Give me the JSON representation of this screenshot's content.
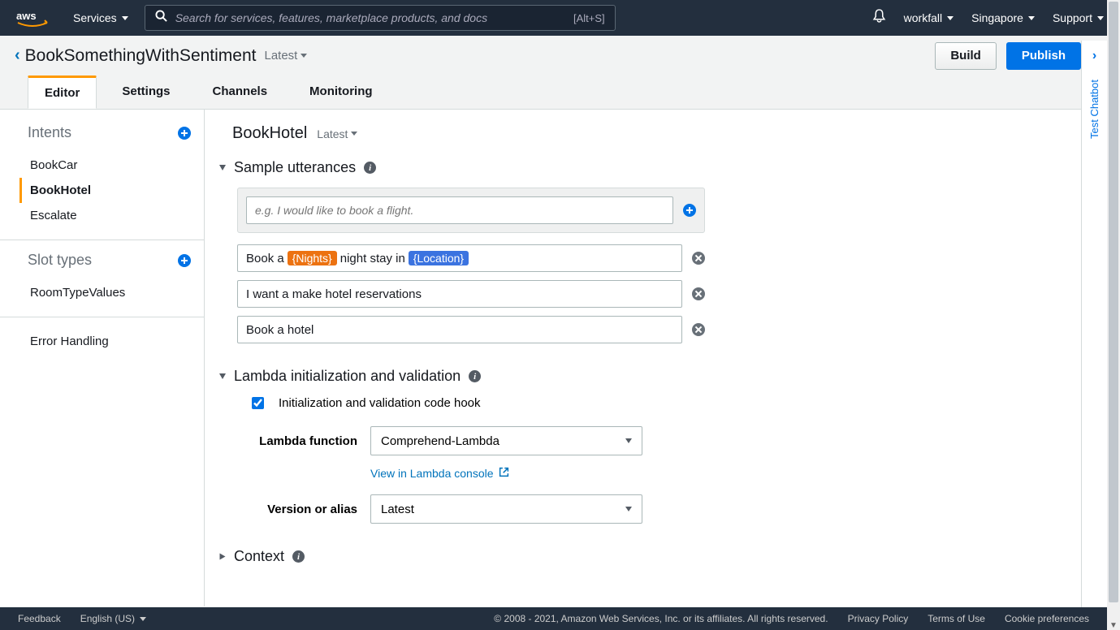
{
  "topnav": {
    "services": "Services",
    "search_placeholder": "Search for services, features, marketplace products, and docs",
    "search_shortcut": "[Alt+S]",
    "account": "workfall",
    "region": "Singapore",
    "support": "Support"
  },
  "crumb": {
    "title": "BookSomethingWithSentiment",
    "version": "Latest",
    "build": "Build",
    "publish": "Publish"
  },
  "tabs": {
    "editor": "Editor",
    "settings": "Settings",
    "channels": "Channels",
    "monitoring": "Monitoring"
  },
  "sidebar": {
    "intents_head": "Intents",
    "intents": [
      "BookCar",
      "BookHotel",
      "Escalate"
    ],
    "slottypes_head": "Slot types",
    "slottypes": [
      "RoomTypeValues"
    ],
    "error_handling": "Error Handling"
  },
  "intent": {
    "name": "BookHotel",
    "version": "Latest"
  },
  "utterances": {
    "head": "Sample utterances",
    "placeholder": "e.g. I would like to book a flight.",
    "row0_pre": "Book a ",
    "row0_nights": "{Nights}",
    "row0_mid": " night stay in ",
    "row0_loc": "{Location}",
    "row1": "I want a make hotel reservations",
    "row2": "Book a hotel"
  },
  "lambda": {
    "head": "Lambda initialization and validation",
    "cb_label": "Initialization and validation code hook",
    "fn_label": "Lambda function",
    "fn_value": "Comprehend-Lambda",
    "view_link": "View in Lambda console",
    "ver_label": "Version or alias",
    "ver_value": "Latest"
  },
  "context": {
    "head": "Context"
  },
  "drawer": {
    "label": "Test Chatbot"
  },
  "footer": {
    "feedback": "Feedback",
    "language": "English (US)",
    "copyright": "© 2008 - 2021, Amazon Web Services, Inc. or its affiliates. All rights reserved.",
    "privacy": "Privacy Policy",
    "terms": "Terms of Use",
    "cookies": "Cookie preferences"
  }
}
